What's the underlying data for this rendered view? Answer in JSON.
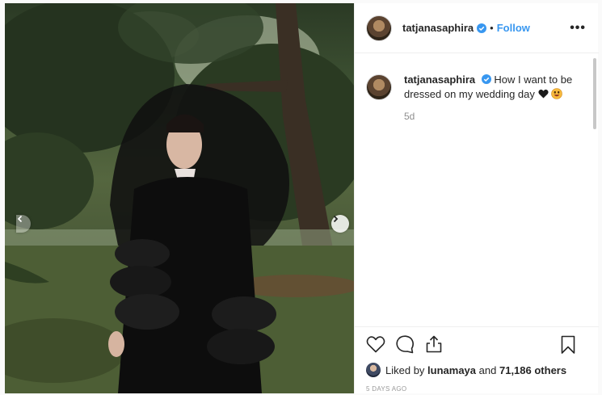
{
  "post": {
    "username": "tatjanasaphira",
    "follow_label": "Follow",
    "separator": "•",
    "more_label": "•••",
    "caption_username": "tatjanasaphira",
    "caption_text": "How I want to be dressed on my wedding day",
    "caption_emojis": [
      "black-heart-emoji",
      "smiling-face-emoji"
    ],
    "time_ago": "5d",
    "liked_by_prefix": "Liked by",
    "liked_by_user": "lunamaya",
    "liked_by_connector": "and",
    "liked_by_count": "71,186 others",
    "date": "5 DAYS AGO"
  },
  "photo": {
    "description_icon": "photo",
    "carousel_next_icon": "chevron-right-icon",
    "carousel_prev_icon": "chevron-left-icon"
  },
  "icons": {
    "verified": "verified-badge-icon",
    "like": "heart-outline-icon",
    "comment": "comment-bubble-icon",
    "share": "share-upload-icon",
    "save": "bookmark-icon",
    "more": "more-options-icon"
  },
  "colors": {
    "accent": "#3897f0",
    "text": "#262626",
    "muted": "#8e8e8e",
    "border": "#efefef"
  }
}
